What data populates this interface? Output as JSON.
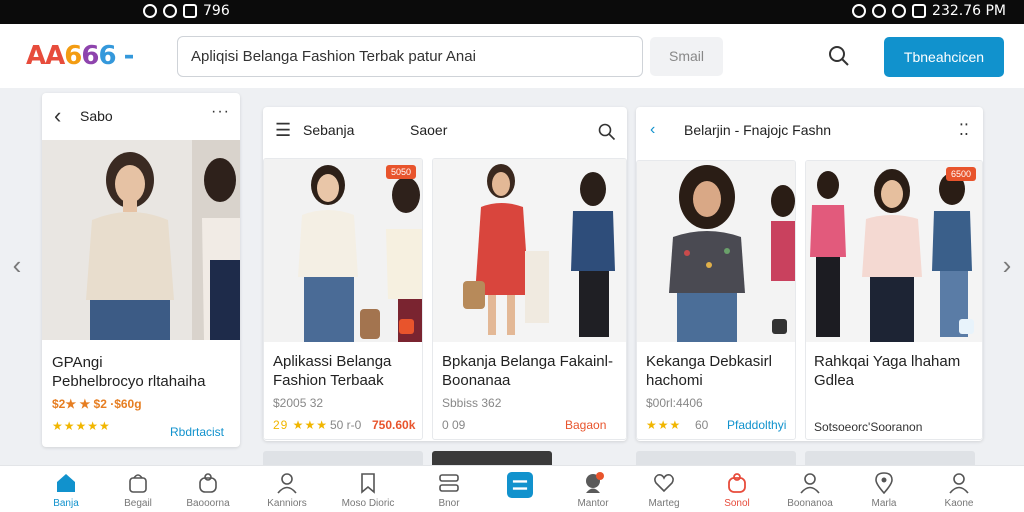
{
  "status_bar": {
    "left_text": "796",
    "right_text": "232.76 PM"
  },
  "header": {
    "logo": "AA666 -",
    "search_value": "Apliqisi Belanga Fashion Terbak patur Anai",
    "search_button": "Smail",
    "primary_button": "Tbneahcicen"
  },
  "panel1": {
    "back_label": "Sabo",
    "card": {
      "title_line1": "GPAngi",
      "title_line2": "Pebhelbrocyo rltahaiha",
      "price": "$2★ ★ $2 ·$60g",
      "rating": "★★★★★",
      "link": "Rbdrtacist"
    }
  },
  "panel2": {
    "title": "Sebanja",
    "subtitle": "Saoer",
    "cards": [
      {
        "tag": "5050",
        "title_line1": "Aplikassi Belanga",
        "title_line2": "Fashion Terbaak",
        "meta": "$2005 32",
        "rating": "29 ★★★",
        "rating_extra": "50 r-0",
        "price": "750.60k"
      },
      {
        "title_line1": "Bpkanja Belanga Fakainl-",
        "title_line2": "Boonanaa",
        "meta": "Sbbiss 362",
        "meta2": "0 09",
        "link": "Bagaon"
      }
    ]
  },
  "panel3": {
    "title": "Belarjin - Fnajojc Fashn",
    "cards": [
      {
        "title_line1": "Kekanga Debkasirl",
        "title_line2": "hachomi",
        "meta": "$00rl:4406",
        "rating": "★★★",
        "rating_extra": "60",
        "link": "Pfaddolthyi"
      },
      {
        "tag": "6500",
        "title_line1": "Rahkqai Yaga lhaham",
        "title_line2": "Gdlea",
        "footer": "Sotsoeorc'Sooranon"
      }
    ]
  },
  "bottom_nav": [
    {
      "label": "Banja",
      "icon": "home-icon"
    },
    {
      "label": "Begail",
      "icon": "bag-icon"
    },
    {
      "label": "Baooorna",
      "icon": "bag-icon"
    },
    {
      "label": "Kanniors",
      "icon": "user-icon"
    },
    {
      "label": "Moso Dioric",
      "icon": "bookmark-icon"
    },
    {
      "label": "Bnor",
      "icon": "list-icon"
    },
    {
      "label": "",
      "icon": "menu-icon"
    },
    {
      "label": "Mantor",
      "icon": "notification-icon"
    },
    {
      "label": "Marteg",
      "icon": "heart-icon"
    },
    {
      "label": "Sonol",
      "icon": "bag-icon"
    },
    {
      "label": "Boonanoa",
      "icon": "user-icon"
    },
    {
      "label": "Marla",
      "icon": "pin-icon"
    },
    {
      "label": "Kaone",
      "icon": "user-icon"
    }
  ],
  "colors": {
    "accent": "#1192cd",
    "tag": "#e8542c",
    "star": "#f1b600",
    "price": "#e67e22"
  }
}
